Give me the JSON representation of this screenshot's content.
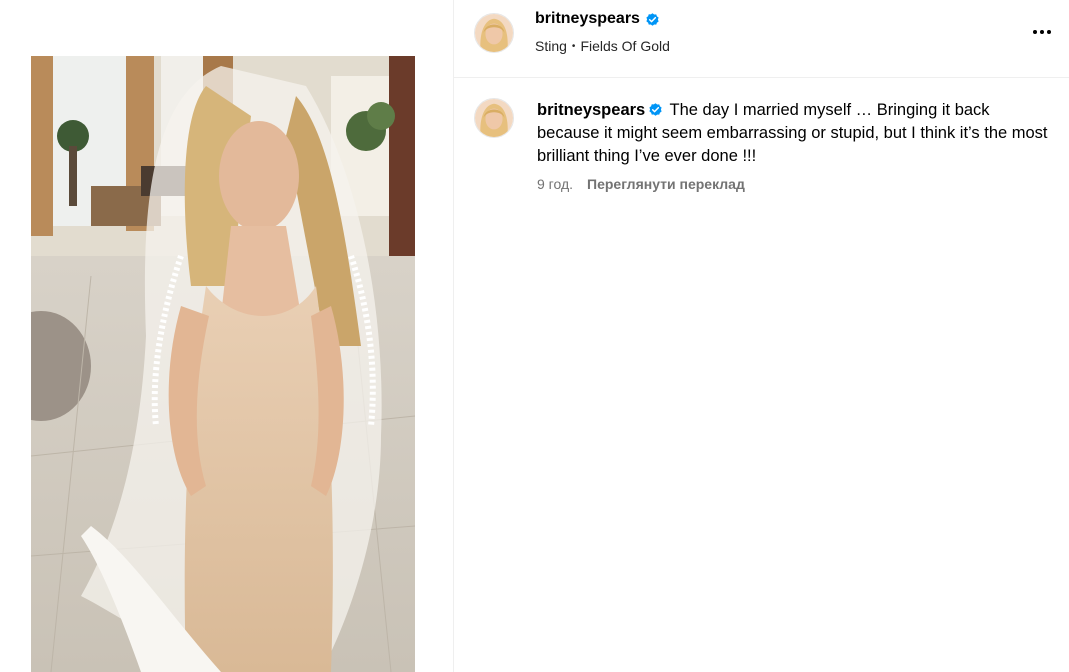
{
  "post": {
    "username": "britneyspears",
    "music": {
      "artist": "Sting",
      "separator": "•",
      "song": "Fields Of Gold"
    }
  },
  "caption": {
    "username": "britneyspears",
    "text": "The day I married myself … Bringing it back because it might seem embarrassing or stupid, but I think it’s the most brilliant thing I’ve ever done !!!",
    "time": "9 год.",
    "translate_label": "Переглянути переклад"
  },
  "icons": {
    "verified": "verified-badge-icon",
    "more": "more-options-icon"
  },
  "colors": {
    "verified": "#0095f6",
    "secondary_text": "#737373",
    "divider": "#efefef"
  }
}
